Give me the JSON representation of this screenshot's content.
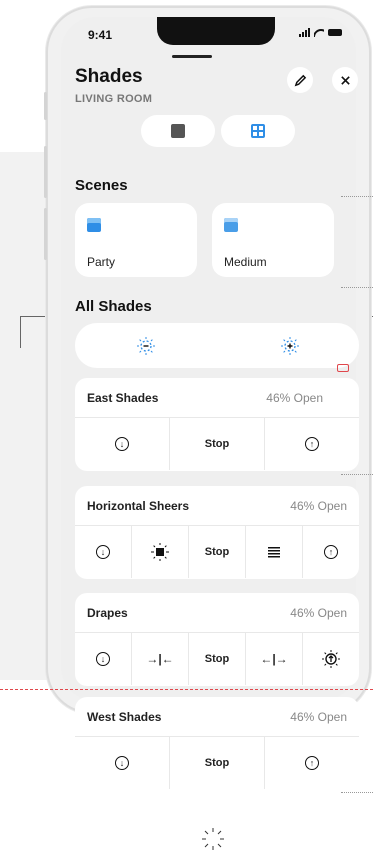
{
  "status_bar": {
    "time": "9:41"
  },
  "header": {
    "title": "Shades",
    "subtitle": "LIVING ROOM",
    "edit_icon": "pencil-icon",
    "close_icon": "close-icon"
  },
  "view_toggle": {
    "list_icon": "blocks-icon",
    "grid_icon": "grid-icon",
    "active": "grid"
  },
  "scenes": {
    "title": "Scenes",
    "items": [
      {
        "label": "Party",
        "icon": "blind-icon",
        "color": "#2f8ee6"
      },
      {
        "label": "Medium",
        "icon": "window-icon",
        "color": "#4a9ee8"
      }
    ]
  },
  "all_shades": {
    "title": "All Shades",
    "close_all_icon": "dim-minus-icon",
    "open_all_icon": "bright-plus-icon"
  },
  "shades": [
    {
      "name": "East Shades",
      "status": "46% Open",
      "controls": [
        "down",
        "Stop",
        "up"
      ]
    },
    {
      "name": "Horizontal Sheers",
      "status": "46% Open",
      "controls": [
        "down",
        "light",
        "Stop",
        "lines",
        "up"
      ]
    },
    {
      "name": "Drapes",
      "status": "46% Open",
      "controls": [
        "down",
        "close-in",
        "Stop",
        "open-out",
        "light"
      ]
    },
    {
      "name": "West Shades",
      "status": "46% Open",
      "controls": [
        "down",
        "Stop",
        "up"
      ]
    }
  ],
  "colors": {
    "accent": "#2f8ee6",
    "warning": "#e0474c"
  }
}
